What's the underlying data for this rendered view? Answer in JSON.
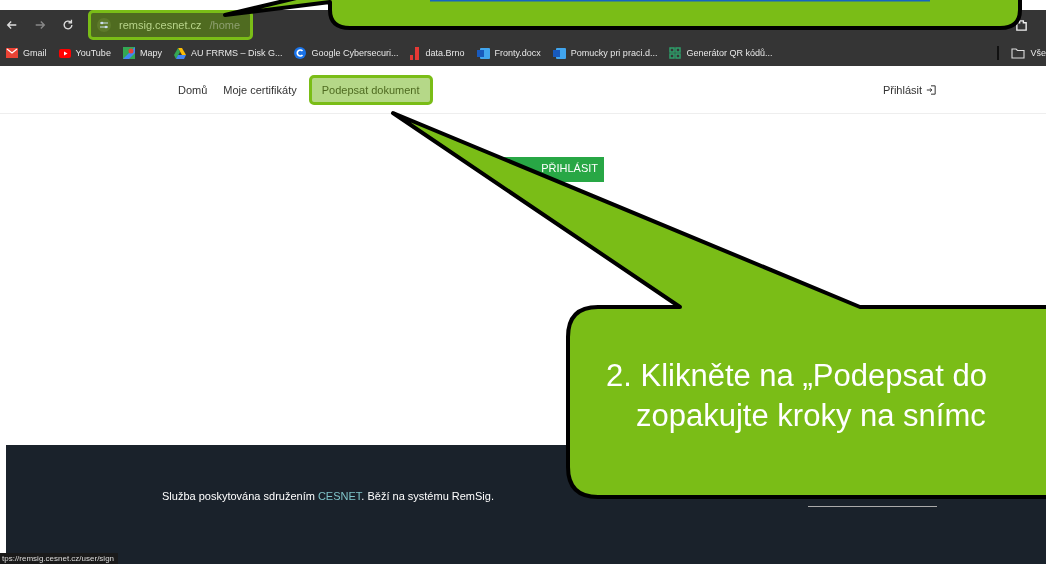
{
  "browser": {
    "url_host": "remsig.cesnet.cz",
    "url_path": "/home",
    "url_highlighted": true,
    "bookmarks": [
      {
        "label": "Gmail",
        "kind": "mail"
      },
      {
        "label": "YouTube",
        "kind": "video"
      },
      {
        "label": "Mapy",
        "kind": "map"
      },
      {
        "label": "AU FRRMS – Disk G...",
        "kind": "drive"
      },
      {
        "label": "Google Cybersecuri...",
        "kind": "circle"
      },
      {
        "label": "data.Brno",
        "kind": "bars"
      },
      {
        "label": "Fronty.docx",
        "kind": "doc"
      },
      {
        "label": "Pomucky pri praci.d...",
        "kind": "doc"
      },
      {
        "label": "Generátor QR kódů...",
        "kind": "grid"
      }
    ],
    "all_bookmarks": "Vše"
  },
  "page": {
    "nav": [
      {
        "label": "Domů",
        "selected": false
      },
      {
        "label": "Moje certifikáty",
        "selected": false
      },
      {
        "label": "Podepsat dokument",
        "selected": true
      }
    ],
    "login": "Přihlásit",
    "button": "PŘIHLÁSIT",
    "footer": {
      "text_before": "Služba poskytována sdružením ",
      "link": "CESNET",
      "text_after": ". Běží na systému RemSig."
    }
  },
  "status_url": "tps://remsig.cesnet.cz/user/sign",
  "callouts": [
    {
      "kind": "link"
    },
    {
      "kind": "text",
      "lines": [
        "2. Klikněte na „Podepsat do",
        "zopakujte kroky na snímc"
      ]
    }
  ]
}
